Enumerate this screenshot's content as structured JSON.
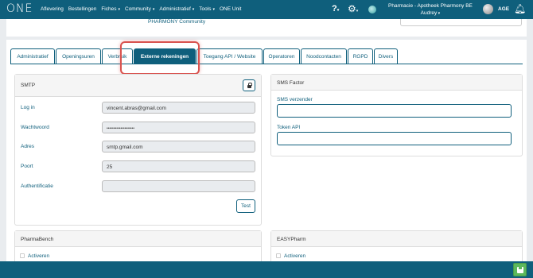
{
  "app": {
    "logo": "ONE",
    "nav": [
      {
        "label": "Aflevering",
        "dropdown": false
      },
      {
        "label": "Bestellingen",
        "dropdown": false
      },
      {
        "label": "Fiches",
        "dropdown": true
      },
      {
        "label": "Community",
        "dropdown": true
      },
      {
        "label": "Administratief",
        "dropdown": true
      },
      {
        "label": "Tools",
        "dropdown": true
      },
      {
        "label": "ONE Unit",
        "dropdown": false
      }
    ],
    "pharmacy_name": "Pharmacie - Apotheek Pharmony BE",
    "user_name": "Audrey",
    "user_code": "AGE",
    "help_icon": "question-mark-icon",
    "settings_icon": "gear-icon",
    "status_icon": "globe-icon",
    "notifications_icon": "bell-icon"
  },
  "header_partial": {
    "community_text": "PHARMONY Community"
  },
  "tabs": [
    {
      "label": "Administratief",
      "active": false
    },
    {
      "label": "Openingsuren",
      "active": false
    },
    {
      "label": "Verbruik",
      "active": false
    },
    {
      "label": "Externe rekeningen",
      "active": true
    },
    {
      "label": "Toegang API / Website",
      "active": false
    },
    {
      "label": "Operatoren",
      "active": false
    },
    {
      "label": "Noodcontacten",
      "active": false
    },
    {
      "label": "RGPD",
      "active": false
    },
    {
      "label": "Divers",
      "active": false
    }
  ],
  "smtp": {
    "title": "SMTP",
    "lock_icon": "lock-icon",
    "fields": [
      {
        "label": "Log in",
        "value": "vincent.abras@gmail.com"
      },
      {
        "label": "Wachtwoord",
        "value": "••••••••••••••••••••"
      },
      {
        "label": "Adres",
        "value": "smtp.gmail.com"
      },
      {
        "label": "Poort",
        "value": "25"
      },
      {
        "label": "Authentificatie",
        "value": ""
      }
    ],
    "test_label": "Test"
  },
  "sms": {
    "title": "SMS Factor",
    "sender_label": "SMS verzender",
    "sender_value": "",
    "token_label": "Token API",
    "token_value": ""
  },
  "pharmabench": {
    "title": "PharmaBench",
    "checkbox_label": "Activeren"
  },
  "easypharm": {
    "title": "EASYPharm",
    "checkbox_label": "Activeren"
  },
  "footer": {
    "save_icon": "save-icon"
  },
  "colors": {
    "primary": "#0f5f7c",
    "highlight": "#d9534f",
    "save": "#5cb85c"
  }
}
